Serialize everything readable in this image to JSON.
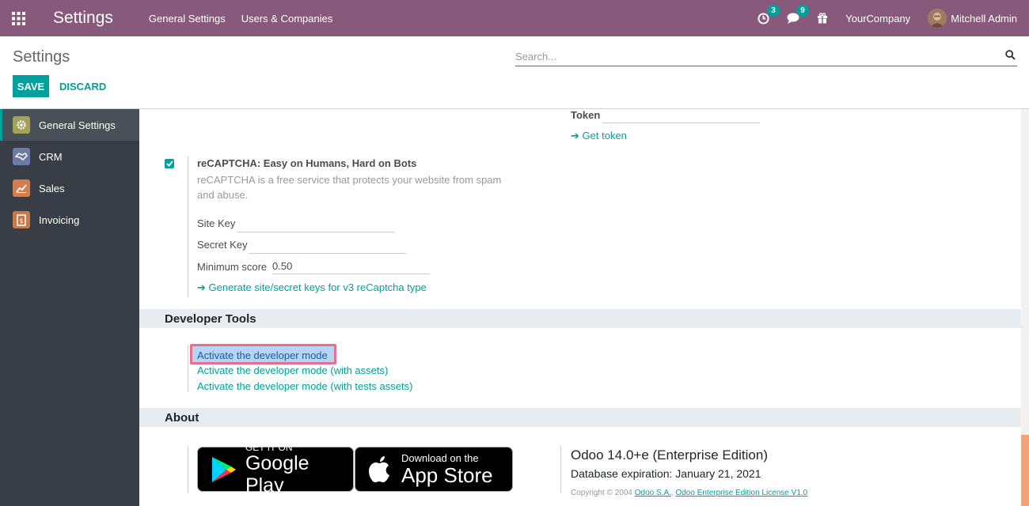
{
  "navbar": {
    "brand": "Settings",
    "menu": [
      "General Settings",
      "Users & Companies"
    ],
    "activity_count": "3",
    "message_count": "9",
    "company": "YourCompany",
    "user": "Mitchell Admin"
  },
  "control_panel": {
    "title": "Settings",
    "search_placeholder": "Search...",
    "save_label": "SAVE",
    "discard_label": "DISCARD"
  },
  "sidebar": {
    "items": [
      {
        "label": "General Settings",
        "icon": "gear-icon",
        "color": "#a3a15a"
      },
      {
        "label": "CRM",
        "icon": "handshake-icon",
        "color": "#6c7ba6"
      },
      {
        "label": "Sales",
        "icon": "chart-icon",
        "color": "#d27f4f"
      },
      {
        "label": "Invoicing",
        "icon": "invoice-icon",
        "color": "#c9794a"
      }
    ]
  },
  "main": {
    "token_label": "Token",
    "get_token": "Get token",
    "recaptcha": {
      "title": "reCAPTCHA: Easy on Humans, Hard on Bots",
      "description": "reCAPTCHA is a free service that protects your website from spam and abuse.",
      "site_key_label": "Site Key",
      "secret_key_label": "Secret Key",
      "min_score_label": "Minimum score",
      "min_score_value": "0.50",
      "generate_link": "Generate site/secret keys for v3 reCaptcha type"
    },
    "developer_tools": {
      "heading": "Developer Tools",
      "links": [
        "Activate the developer mode",
        "Activate the developer mode (with assets)",
        "Activate the developer mode (with tests assets)"
      ]
    },
    "about": {
      "heading": "About",
      "google_play_small": "GET IT ON",
      "google_play_big": "Google Play",
      "app_store_small": "Download on the",
      "app_store_big": "App Store",
      "version": "Odoo 14.0+e (Enterprise Edition)",
      "expiration": "Database expiration: January 21, 2021",
      "copyright_prefix": "Copyright © 2004",
      "copyright_link1": "Odoo S.A.",
      "copyright_link2": "Odoo Enterprise Edition License V1.0"
    }
  },
  "colors": {
    "brand": "#875a7b",
    "accent": "#00a09d",
    "sidebar_bg": "#393e46"
  }
}
